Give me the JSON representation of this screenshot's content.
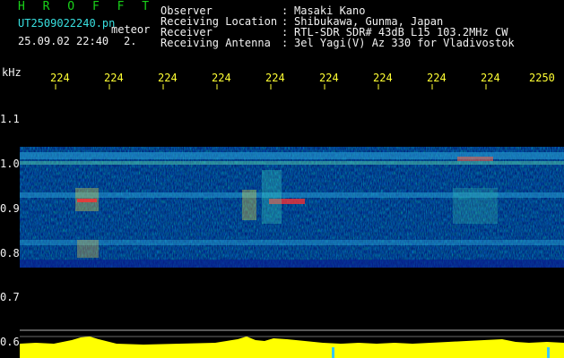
{
  "header": {
    "app_name": "H R O F F T",
    "filename": "UT2509022240.pn",
    "filename_suffix": "meteor",
    "datetime": "25.09.02 22:40",
    "frame_index": "2.",
    "fields": [
      {
        "label": "Observer",
        "value": "Masaki Kano"
      },
      {
        "label": "Receiving Location",
        "value": "Shibukawa, Gunma, Japan"
      },
      {
        "label": "Receiver",
        "value": "RTL-SDR SDR# 43dB L15 103.2MHz CW"
      },
      {
        "label": "Receiving Antenna",
        "value": "3el Yagi(V) Az 330 for Vladivostok"
      }
    ]
  },
  "axes": {
    "y_unit": "kHz",
    "y_ticks": [
      "1.1",
      "1.0",
      "0.9",
      "0.8",
      "0.7",
      "0.6"
    ],
    "time_ticks": [
      "224",
      "224",
      "224",
      "224",
      "224",
      "224",
      "224",
      "224",
      "224",
      "2250"
    ]
  },
  "colors": {
    "header_title": "#19d219",
    "header_file": "#38e0e0",
    "header_text": "#f2f2f2",
    "time_labels": "#ffff33",
    "power_trace": "#ffff00"
  }
}
